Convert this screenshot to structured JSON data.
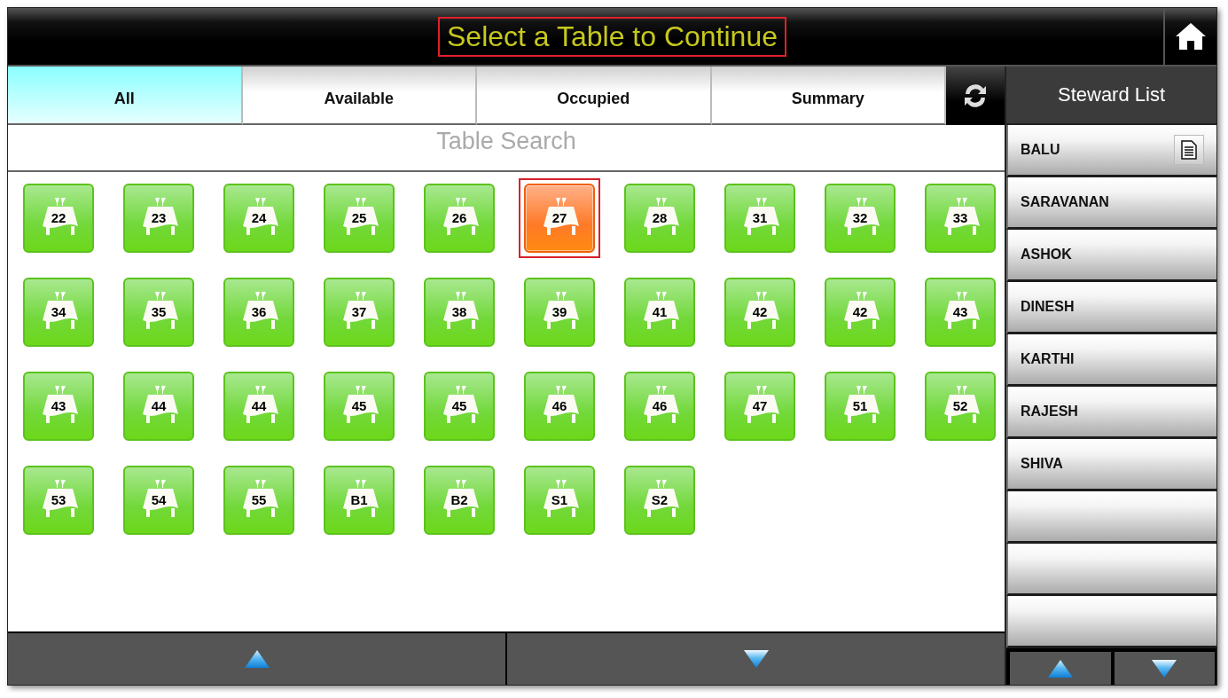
{
  "header": {
    "title": "Select a Table to Continue"
  },
  "tabs": [
    {
      "label": "All",
      "selected": true
    },
    {
      "label": "Available",
      "selected": false
    },
    {
      "label": "Occupied",
      "selected": false
    },
    {
      "label": "Summary",
      "selected": false
    }
  ],
  "search": {
    "placeholder": "Table Search"
  },
  "tables": [
    {
      "number": "22",
      "kind": "available",
      "selected": false
    },
    {
      "number": "23",
      "kind": "available",
      "selected": false
    },
    {
      "number": "24",
      "kind": "available",
      "selected": false
    },
    {
      "number": "25",
      "kind": "available",
      "selected": false
    },
    {
      "number": "26",
      "kind": "available",
      "selected": false
    },
    {
      "number": "27",
      "kind": "occupied",
      "selected": true
    },
    {
      "number": "28",
      "kind": "available",
      "selected": false
    },
    {
      "number": "31",
      "kind": "available",
      "selected": false
    },
    {
      "number": "32",
      "kind": "available",
      "selected": false
    },
    {
      "number": "33",
      "kind": "available",
      "selected": false
    },
    {
      "number": "34",
      "kind": "available",
      "selected": false
    },
    {
      "number": "35",
      "kind": "available",
      "selected": false
    },
    {
      "number": "36",
      "kind": "available",
      "selected": false
    },
    {
      "number": "37",
      "kind": "available",
      "selected": false
    },
    {
      "number": "38",
      "kind": "available",
      "selected": false
    },
    {
      "number": "39",
      "kind": "available",
      "selected": false
    },
    {
      "number": "41",
      "kind": "available",
      "selected": false
    },
    {
      "number": "42",
      "kind": "available",
      "selected": false
    },
    {
      "number": "42",
      "kind": "available",
      "selected": false
    },
    {
      "number": "43",
      "kind": "available",
      "selected": false
    },
    {
      "number": "43",
      "kind": "available",
      "selected": false
    },
    {
      "number": "44",
      "kind": "available",
      "selected": false
    },
    {
      "number": "44",
      "kind": "available",
      "selected": false
    },
    {
      "number": "45",
      "kind": "available",
      "selected": false
    },
    {
      "number": "45",
      "kind": "available",
      "selected": false
    },
    {
      "number": "46",
      "kind": "available",
      "selected": false
    },
    {
      "number": "46",
      "kind": "available",
      "selected": false
    },
    {
      "number": "47",
      "kind": "available",
      "selected": false
    },
    {
      "number": "51",
      "kind": "available",
      "selected": false
    },
    {
      "number": "52",
      "kind": "available",
      "selected": false
    },
    {
      "number": "53",
      "kind": "available",
      "selected": false
    },
    {
      "number": "54",
      "kind": "available",
      "selected": false
    },
    {
      "number": "55",
      "kind": "available",
      "selected": false
    },
    {
      "number": "B1",
      "kind": "available",
      "selected": false
    },
    {
      "number": "B2",
      "kind": "available",
      "selected": false
    },
    {
      "number": "S1",
      "kind": "available",
      "selected": false
    },
    {
      "number": "S2",
      "kind": "available",
      "selected": false
    }
  ],
  "steward_list": {
    "title": "Steward List",
    "items": [
      {
        "kind": "named",
        "name": "BALU",
        "has_notes": true
      },
      {
        "kind": "named",
        "name": "SARAVANAN",
        "has_notes": false
      },
      {
        "kind": "named",
        "name": "ASHOK",
        "has_notes": false
      },
      {
        "kind": "named",
        "name": "DINESH",
        "has_notes": false
      },
      {
        "kind": "named",
        "name": "KARTHI",
        "has_notes": false
      },
      {
        "kind": "named",
        "name": "RAJESH",
        "has_notes": false
      },
      {
        "kind": "named",
        "name": "SHIVA",
        "has_notes": false
      },
      {
        "kind": "blank"
      },
      {
        "kind": "blank"
      },
      {
        "kind": "blank"
      }
    ]
  }
}
